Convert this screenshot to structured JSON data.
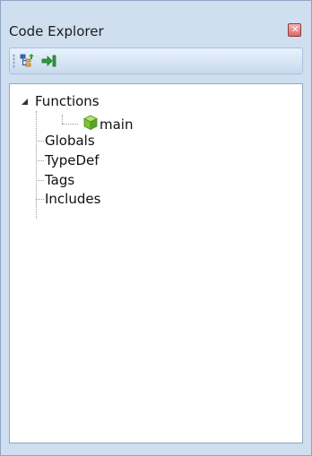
{
  "panel": {
    "title": "Code Explorer",
    "close_icon": "close-icon"
  },
  "toolbar": {
    "buttons": [
      {
        "icon": "tree-view-icon"
      },
      {
        "icon": "jump-to-icon"
      }
    ]
  },
  "tree": {
    "functions_label": "Functions",
    "function_items": [
      {
        "label": "main",
        "icon": "cube-icon"
      }
    ],
    "globals_label": "Globals",
    "typedef_label": "TypeDef",
    "tags_label": "Tags",
    "includes_label": "Includes"
  },
  "colors": {
    "panel_bg": "#cfdff0",
    "border": "#8fa6c4",
    "close_red": "#d96b6b",
    "cube_green": "#7bc43a"
  }
}
